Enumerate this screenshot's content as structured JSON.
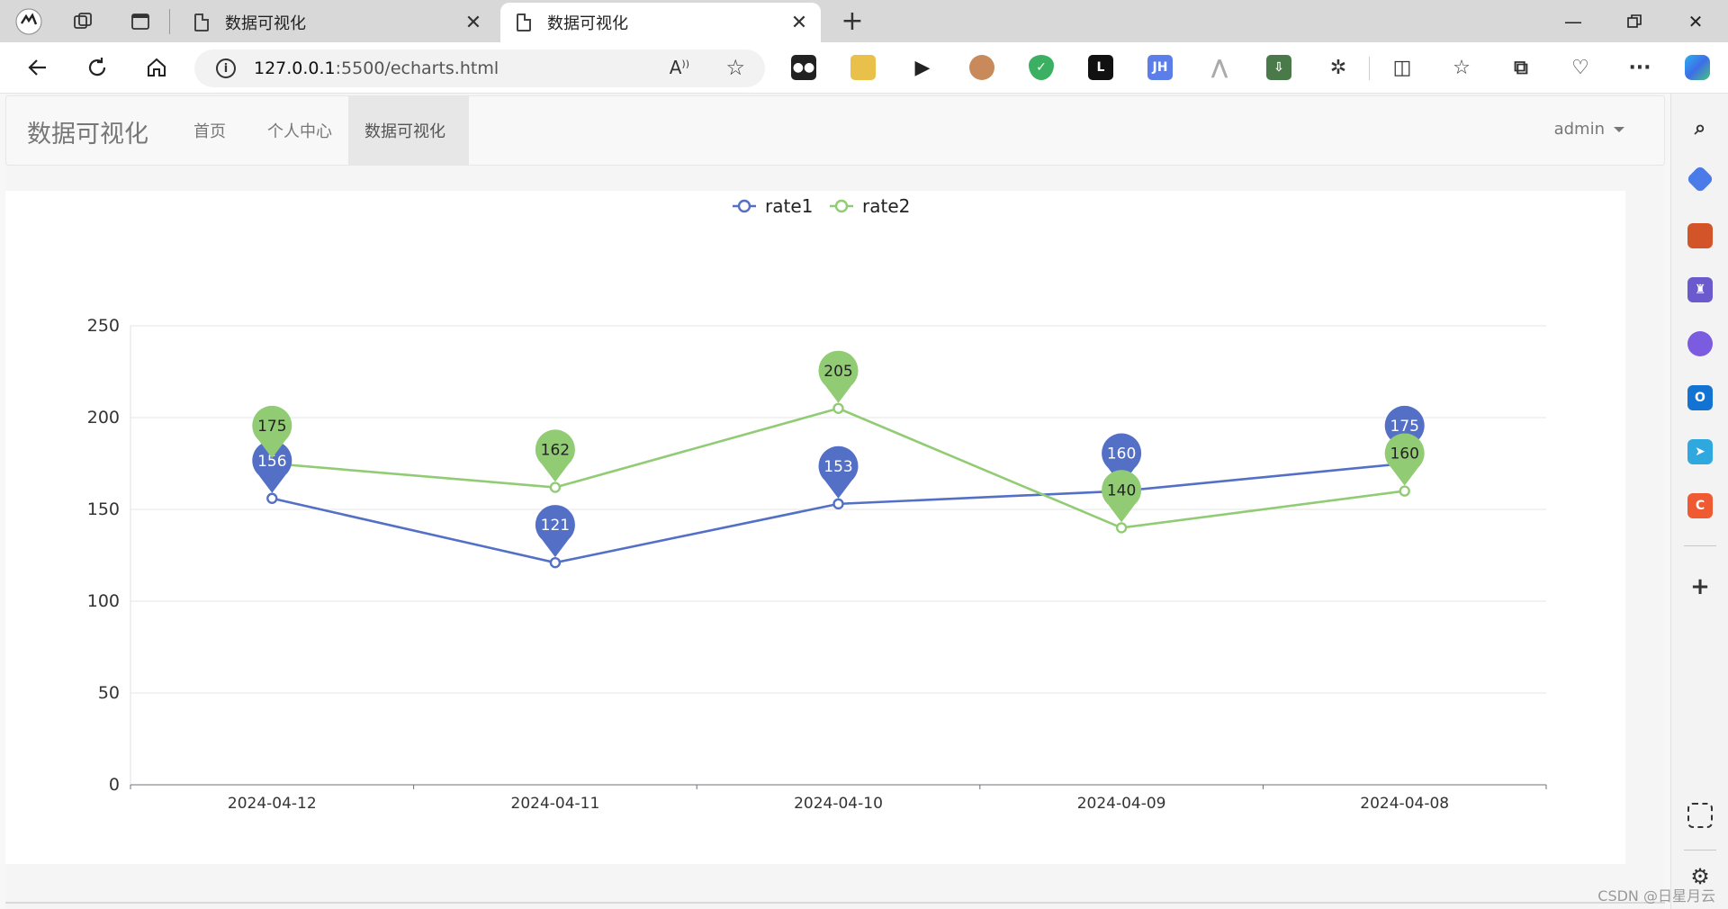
{
  "browser": {
    "tabs": [
      {
        "title": "数据可视化",
        "active": false
      },
      {
        "title": "数据可视化",
        "active": true
      }
    ],
    "url_host": "127.0.0.1",
    "url_path": ":5500/echarts.html"
  },
  "navbar": {
    "brand": "数据可视化",
    "items": [
      {
        "label": "首页"
      },
      {
        "label": "个人中心"
      },
      {
        "label": "数据可视化"
      }
    ],
    "active_index": 2,
    "user": "admin"
  },
  "chart_data": {
    "type": "line",
    "categories": [
      "2024-04-12",
      "2024-04-11",
      "2024-04-10",
      "2024-04-09",
      "2024-04-08"
    ],
    "series": [
      {
        "name": "rate1",
        "color": "#5470c6",
        "values": [
          156,
          121,
          153,
          160,
          175
        ]
      },
      {
        "name": "rate2",
        "color": "#91cc75",
        "values": [
          175,
          162,
          205,
          140,
          160
        ]
      }
    ],
    "ylim": [
      0,
      250
    ],
    "yticks": [
      0,
      50,
      100,
      150,
      200,
      250
    ],
    "legend_position": "top-center",
    "markers": "value pins on every point",
    "grid": true
  },
  "watermark": "CSDN @日星月云"
}
